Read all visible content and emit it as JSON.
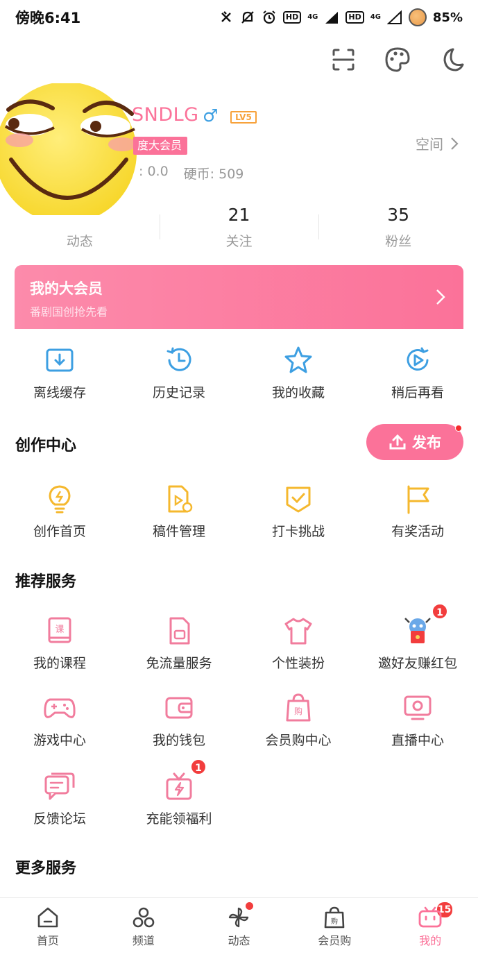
{
  "status_bar": {
    "time": "傍晚6:41",
    "hd1": "HD",
    "net1": "4G",
    "hd2": "HD",
    "net2": "4G",
    "battery": "85%"
  },
  "profile": {
    "username": "SNDLG",
    "gender_symbol": "♂",
    "level": "LV5",
    "vip_label": "度大会员",
    "space_link": "空间",
    "b_coin": ": 0.0",
    "hard_coin": "硬币: 509"
  },
  "stats": [
    {
      "value": "",
      "label": "动态"
    },
    {
      "value": "21",
      "label": "关注"
    },
    {
      "value": "35",
      "label": "粉丝"
    }
  ],
  "vip_card": {
    "title": "我的大会员",
    "subtitle": "番剧国创抢先看"
  },
  "quick_actions": [
    "离线缓存",
    "历史记录",
    "我的收藏",
    "稍后再看"
  ],
  "creator": {
    "title": "创作中心",
    "publish_label": "发布",
    "items": [
      "创作首页",
      "稿件管理",
      "打卡挑战",
      "有奖活动"
    ]
  },
  "recommended": {
    "title": "推荐服务",
    "items": [
      "我的课程",
      "免流量服务",
      "个性装扮",
      "邀好友赚红包",
      "游戏中心",
      "我的钱包",
      "会员购中心",
      "直播中心",
      "反馈论坛",
      "充能领福利"
    ],
    "invite_badge": "1",
    "charge_badge": "1"
  },
  "more": {
    "title": "更多服务"
  },
  "tabbar": {
    "items": [
      "首页",
      "频道",
      "动态",
      "会员购",
      "我的"
    ],
    "dynamic_badge": "15"
  },
  "colors": {
    "accent": "#fb7299",
    "blue_icon": "#3d9fe2",
    "yellow_icon": "#f5b82e"
  }
}
